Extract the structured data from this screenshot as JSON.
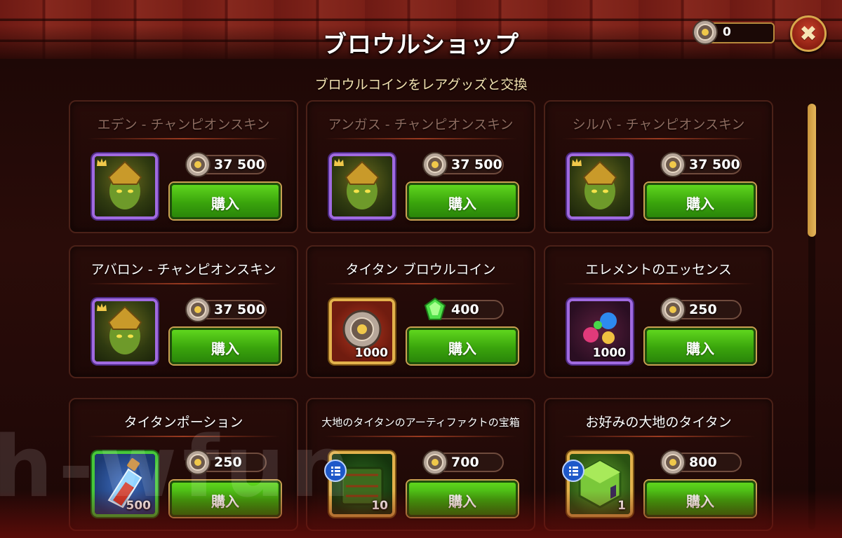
{
  "header": {
    "title": "ブロウルショップ",
    "subtitle": "ブロウルコインをレアグッズと交換",
    "currency_value": "0",
    "close_label": "✖"
  },
  "colors": {
    "buy_green": "#3aa40c",
    "frame_purple": "#a06ae0",
    "frame_gold": "#e3b24c",
    "frame_green": "#47c83a",
    "title_text": "#ffffff",
    "subtitle_text": "#f3e2b0"
  },
  "items": [
    {
      "title": "エデン - チャンピオンスキン",
      "price": "37 500",
      "currency_icon": "brawl-coin-icon",
      "buy_label": "購入",
      "quantity": "",
      "frame": "purple",
      "art": "hero-skin-eden"
    },
    {
      "title": "アンガス - チャンピオンスキン",
      "price": "37 500",
      "currency_icon": "brawl-coin-icon",
      "buy_label": "購入",
      "quantity": "",
      "frame": "purple",
      "art": "hero-skin-angus"
    },
    {
      "title": "シルバ - チャンピオンスキン",
      "price": "37 500",
      "currency_icon": "brawl-coin-icon",
      "buy_label": "購入",
      "quantity": "",
      "frame": "purple",
      "art": "hero-skin-silva"
    },
    {
      "title": "アバロン - チャンピオンスキン",
      "price": "37 500",
      "currency_icon": "brawl-coin-icon",
      "buy_label": "購入",
      "quantity": "",
      "frame": "purple",
      "art": "hero-skin-avalon"
    },
    {
      "title": "タイタン ブロウルコイン",
      "price": "400",
      "currency_icon": "emerald-gem-icon",
      "buy_label": "購入",
      "quantity": "1000",
      "frame": "gold",
      "art": "titan-brawl-coin"
    },
    {
      "title": "エレメントのエッセンス",
      "price": "250",
      "currency_icon": "brawl-coin-icon",
      "buy_label": "購入",
      "quantity": "1000",
      "frame": "purple",
      "art": "element-essence"
    },
    {
      "title": "タイタンポーション",
      "price": "250",
      "currency_icon": "brawl-coin-icon",
      "buy_label": "購入",
      "quantity": "500",
      "frame": "green",
      "art": "titan-potion"
    },
    {
      "title": "大地のタイタンのアーティファクトの宝箱",
      "price": "700",
      "currency_icon": "brawl-coin-icon",
      "buy_label": "購入",
      "quantity": "10",
      "frame": "gold",
      "art": "earth-titan-artifact-chest"
    },
    {
      "title": "お好みの大地のタイタン",
      "price": "800",
      "currency_icon": "brawl-coin-icon",
      "buy_label": "購入",
      "quantity": "1",
      "frame": "gold",
      "art": "earth-titan-choice"
    }
  ],
  "watermark": "h-wfun"
}
